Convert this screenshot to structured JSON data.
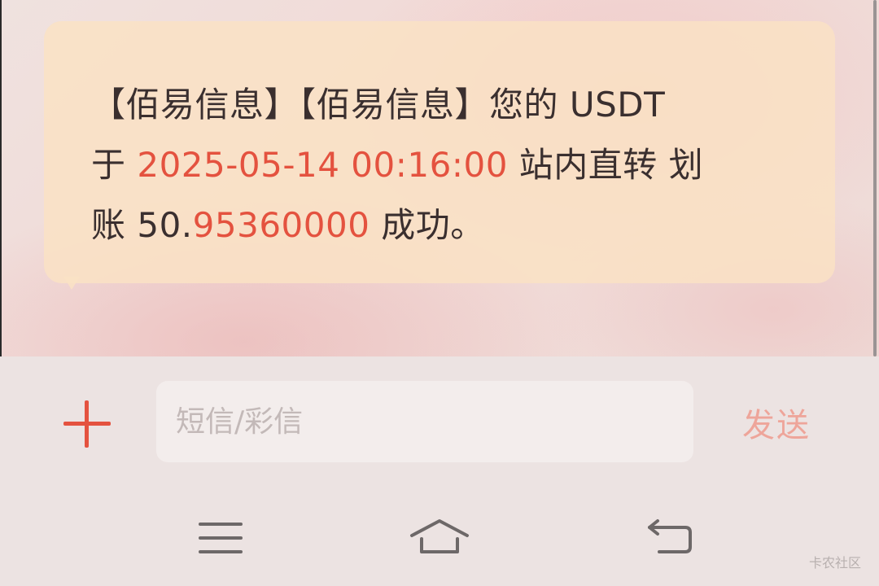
{
  "message": {
    "part1": "【佰易信息】【佰易信息】您的 USDT",
    "line2_prefix": "于 ",
    "datetime": "2025-05-14 00:16:00",
    "line2_suffix": " 站内直转 划",
    "line3_prefix": "账 50.",
    "amount_highlight": "95360000",
    "line3_suffix": " 成功。"
  },
  "compose": {
    "placeholder": "短信/彩信",
    "send_label": "发送"
  },
  "navbar": {
    "icons": [
      "menu-icon",
      "home-icon",
      "back-icon"
    ]
  },
  "watermark": "卡农社区",
  "colors": {
    "accent": "#e4523f",
    "send_disabled": "#eea59a",
    "bubble": "#fae2c4"
  }
}
